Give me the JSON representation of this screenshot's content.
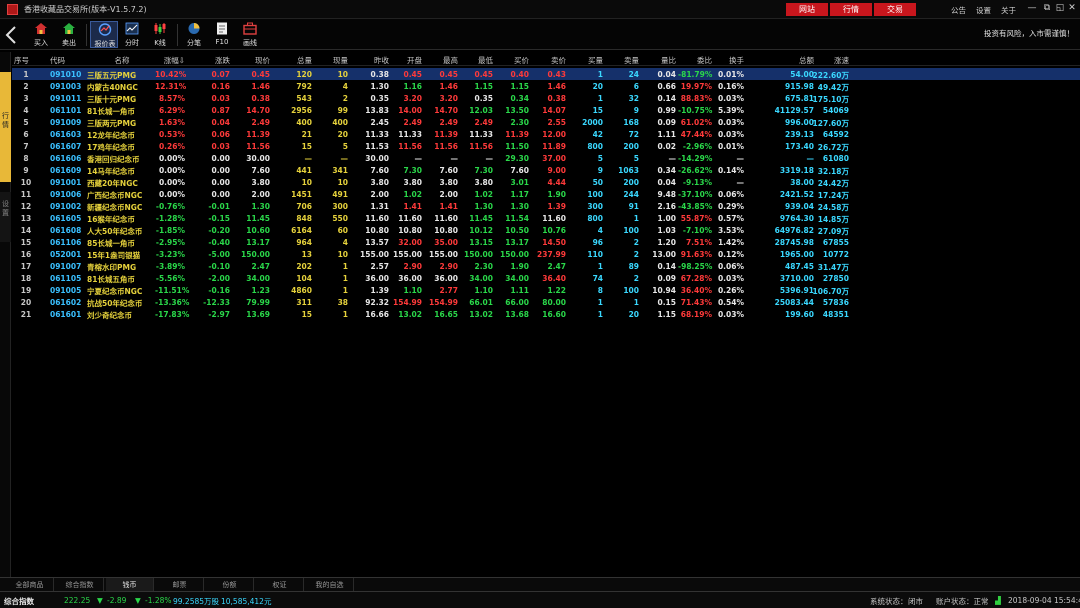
{
  "window": {
    "title": "香港收藏品交易所(版本-V1.5.7.2)",
    "tabs": [
      "网站",
      "行情",
      "交易"
    ],
    "menu": [
      "公告",
      "设置",
      "关于"
    ],
    "controls": [
      "—",
      "⧉",
      "◱",
      "✕"
    ]
  },
  "toolbar": {
    "items": [
      {
        "label": "买入",
        "icon": "house-icon"
      },
      {
        "label": "卖出",
        "icon": "house-icon"
      },
      {
        "label": "报价表",
        "icon": "quote-table-icon"
      },
      {
        "label": "分时",
        "icon": "timeshare-icon"
      },
      {
        "label": "K线",
        "icon": "candlestick-icon"
      },
      {
        "label": "分笔",
        "icon": "pie-icon"
      },
      {
        "label": "F10",
        "icon": "document-icon"
      },
      {
        "label": "画线",
        "icon": "briefcase-icon"
      }
    ],
    "risk_notice": "投资有风险，入市需谨慎！"
  },
  "side_tabs": [
    "行情",
    "设置"
  ],
  "colors": {
    "up": "#ff3a3a",
    "down": "#2ad84a",
    "accent_red": "#c8161d",
    "selected_row": "#15306a",
    "code": "#3ac0ff",
    "name": "#e6d23c"
  },
  "table": {
    "columns": [
      "序号",
      "代码",
      "名称",
      "涨幅⇩",
      "涨跌",
      "现价",
      "总量",
      "现量",
      "昨收",
      "开盘",
      "最高",
      "最低",
      "买价",
      "卖价",
      "买量",
      "卖量",
      "量比",
      "委比",
      "换手",
      "总额",
      "涨速"
    ],
    "rows": [
      {
        "no": "1",
        "code": "091010",
        "name": "三版五元PMG",
        "pct": "10.42%",
        "chg": "0.07",
        "price": "0.45",
        "vol": "120",
        "cur": "10",
        "prev": "0.38",
        "open": "0.45",
        "high": "0.45",
        "low": "0.45",
        "bid": "0.40",
        "ask": "0.43",
        "bv": "1",
        "av": "24",
        "vr": "0.04",
        "wb": "-81.79%",
        "hs": "0.01%",
        "amt": "54.00",
        "spd": "222.60万",
        "dir": "up"
      },
      {
        "no": "2",
        "code": "091003",
        "name": "内蒙古40NGC",
        "pct": "12.31%",
        "chg": "0.16",
        "price": "1.46",
        "vol": "792",
        "cur": "4",
        "prev": "1.30",
        "open": "1.16",
        "high": "1.46",
        "low": "1.15",
        "bid": "1.15",
        "ask": "1.46",
        "bv": "20",
        "av": "6",
        "vr": "0.66",
        "wb": "19.97%",
        "hs": "0.16%",
        "amt": "915.98",
        "spd": "49.42万",
        "dir": "up"
      },
      {
        "no": "3",
        "code": "091011",
        "name": "三版十元PMG",
        "pct": "8.57%",
        "chg": "0.03",
        "price": "0.38",
        "vol": "543",
        "cur": "2",
        "prev": "0.35",
        "open": "3.20",
        "high": "3.20",
        "low": "0.35",
        "bid": "0.34",
        "ask": "0.38",
        "bv": "1",
        "av": "32",
        "vr": "0.14",
        "wb": "88.83%",
        "hs": "0.03%",
        "amt": "675.81",
        "spd": "175.10万",
        "dir": "up"
      },
      {
        "no": "4",
        "code": "061101",
        "name": "81长城一角币",
        "pct": "6.29%",
        "chg": "0.87",
        "price": "14.70",
        "vol": "2956",
        "cur": "99",
        "prev": "13.83",
        "open": "14.00",
        "high": "14.70",
        "low": "12.03",
        "bid": "13.50",
        "ask": "14.07",
        "bv": "15",
        "av": "9",
        "vr": "0.99",
        "wb": "-10.75%",
        "hs": "5.39%",
        "amt": "41129.57",
        "spd": "54069",
        "dir": "up"
      },
      {
        "no": "5",
        "code": "091009",
        "name": "三版两元PMG",
        "pct": "1.63%",
        "chg": "0.04",
        "price": "2.49",
        "vol": "400",
        "cur": "400",
        "prev": "2.45",
        "open": "2.49",
        "high": "2.49",
        "low": "2.49",
        "bid": "2.30",
        "ask": "2.55",
        "bv": "2000",
        "av": "168",
        "vr": "0.09",
        "wb": "61.02%",
        "hs": "0.03%",
        "amt": "996.00",
        "spd": "127.60万",
        "dir": "up"
      },
      {
        "no": "6",
        "code": "061603",
        "name": "12龙年纪念币",
        "pct": "0.53%",
        "chg": "0.06",
        "price": "11.39",
        "vol": "21",
        "cur": "20",
        "prev": "11.33",
        "open": "11.33",
        "high": "11.39",
        "low": "11.33",
        "bid": "11.39",
        "ask": "12.00",
        "bv": "42",
        "av": "72",
        "vr": "1.11",
        "wb": "47.44%",
        "hs": "0.03%",
        "amt": "239.13",
        "spd": "64592",
        "dir": "up"
      },
      {
        "no": "7",
        "code": "061607",
        "name": "17鸡年纪念币",
        "pct": "0.26%",
        "chg": "0.03",
        "price": "11.56",
        "vol": "15",
        "cur": "5",
        "prev": "11.53",
        "open": "11.56",
        "high": "11.56",
        "low": "11.56",
        "bid": "11.50",
        "ask": "11.89",
        "bv": "800",
        "av": "200",
        "vr": "0.02",
        "wb": "-2.96%",
        "hs": "0.01%",
        "amt": "173.40",
        "spd": "26.72万",
        "dir": "up"
      },
      {
        "no": "8",
        "code": "061606",
        "name": "香港回归纪念币",
        "pct": "0.00%",
        "chg": "0.00",
        "price": "30.00",
        "vol": "—",
        "cur": "—",
        "prev": "30.00",
        "open": "—",
        "high": "—",
        "low": "—",
        "bid": "29.30",
        "ask": "37.00",
        "bv": "5",
        "av": "5",
        "vr": "—",
        "wb": "-14.29%",
        "hs": "—",
        "amt": "—",
        "spd": "61080",
        "dir": "eq"
      },
      {
        "no": "9",
        "code": "061609",
        "name": "14马年纪念币",
        "pct": "0.00%",
        "chg": "0.00",
        "price": "7.60",
        "vol": "441",
        "cur": "341",
        "prev": "7.60",
        "open": "7.30",
        "high": "7.60",
        "low": "7.30",
        "bid": "7.60",
        "ask": "9.00",
        "bv": "9",
        "av": "1063",
        "vr": "0.34",
        "wb": "-26.62%",
        "hs": "0.14%",
        "amt": "3319.18",
        "spd": "32.18万",
        "dir": "eq"
      },
      {
        "no": "10",
        "code": "091001",
        "name": "西藏20年NGC",
        "pct": "0.00%",
        "chg": "0.00",
        "price": "3.80",
        "vol": "10",
        "cur": "10",
        "prev": "3.80",
        "open": "3.80",
        "high": "3.80",
        "low": "3.80",
        "bid": "3.01",
        "ask": "4.44",
        "bv": "50",
        "av": "200",
        "vr": "0.04",
        "wb": "-9.13%",
        "hs": "—",
        "amt": "38.00",
        "spd": "24.42万",
        "dir": "eq"
      },
      {
        "no": "11",
        "code": "091006",
        "name": "广西纪念币NGC",
        "pct": "0.00%",
        "chg": "0.00",
        "price": "2.00",
        "vol": "1451",
        "cur": "491",
        "prev": "2.00",
        "open": "1.02",
        "high": "2.00",
        "low": "1.02",
        "bid": "1.17",
        "ask": "1.90",
        "bv": "100",
        "av": "244",
        "vr": "9.48",
        "wb": "-37.10%",
        "hs": "0.06%",
        "amt": "2421.52",
        "spd": "17.24万",
        "dir": "eq"
      },
      {
        "no": "12",
        "code": "091002",
        "name": "新疆纪念币NGC",
        "pct": "-0.76%",
        "chg": "-0.01",
        "price": "1.30",
        "vol": "706",
        "cur": "300",
        "prev": "1.31",
        "open": "1.41",
        "high": "1.41",
        "low": "1.30",
        "bid": "1.30",
        "ask": "1.39",
        "bv": "300",
        "av": "91",
        "vr": "2.16",
        "wb": "-43.85%",
        "hs": "0.29%",
        "amt": "939.04",
        "spd": "24.58万",
        "dir": "dn"
      },
      {
        "no": "13",
        "code": "061605",
        "name": "16猴年纪念币",
        "pct": "-1.28%",
        "chg": "-0.15",
        "price": "11.45",
        "vol": "848",
        "cur": "550",
        "prev": "11.60",
        "open": "11.60",
        "high": "11.60",
        "low": "11.45",
        "bid": "11.54",
        "ask": "11.60",
        "bv": "800",
        "av": "1",
        "vr": "1.00",
        "wb": "55.87%",
        "hs": "0.57%",
        "amt": "9764.30",
        "spd": "14.85万",
        "dir": "dn"
      },
      {
        "no": "14",
        "code": "061608",
        "name": "人大50年纪念币",
        "pct": "-1.85%",
        "chg": "-0.20",
        "price": "10.60",
        "vol": "6164",
        "cur": "60",
        "prev": "10.80",
        "open": "10.80",
        "high": "10.80",
        "low": "10.12",
        "bid": "10.50",
        "ask": "10.76",
        "bv": "4",
        "av": "100",
        "vr": "1.03",
        "wb": "-7.10%",
        "hs": "3.53%",
        "amt": "64976.82",
        "spd": "27.09万",
        "dir": "dn"
      },
      {
        "no": "15",
        "code": "061106",
        "name": "85长城一角币",
        "pct": "-2.95%",
        "chg": "-0.40",
        "price": "13.17",
        "vol": "964",
        "cur": "4",
        "prev": "13.57",
        "open": "32.00",
        "high": "35.00",
        "low": "13.15",
        "bid": "13.17",
        "ask": "14.50",
        "bv": "96",
        "av": "2",
        "vr": "1.20",
        "wb": "7.51%",
        "hs": "1.42%",
        "amt": "28745.98",
        "spd": "67855",
        "dir": "dn"
      },
      {
        "no": "16",
        "code": "052001",
        "name": "15年1盎司银猫",
        "pct": "-3.23%",
        "chg": "-5.00",
        "price": "150.00",
        "vol": "13",
        "cur": "10",
        "prev": "155.00",
        "open": "155.00",
        "high": "155.00",
        "low": "150.00",
        "bid": "150.00",
        "ask": "237.99",
        "bv": "110",
        "av": "2",
        "vr": "13.00",
        "wb": "91.63%",
        "hs": "0.12%",
        "amt": "1965.00",
        "spd": "10772",
        "dir": "dn"
      },
      {
        "no": "17",
        "code": "091007",
        "name": "青榕水印PMG",
        "pct": "-3.89%",
        "chg": "-0.10",
        "price": "2.47",
        "vol": "202",
        "cur": "1",
        "prev": "2.57",
        "open": "2.90",
        "high": "2.90",
        "low": "2.30",
        "bid": "1.90",
        "ask": "2.47",
        "bv": "1",
        "av": "89",
        "vr": "0.14",
        "wb": "-98.25%",
        "hs": "0.06%",
        "amt": "487.45",
        "spd": "31.47万",
        "dir": "dn"
      },
      {
        "no": "18",
        "code": "061105",
        "name": "81长城五角币",
        "pct": "-5.56%",
        "chg": "-2.00",
        "price": "34.00",
        "vol": "104",
        "cur": "1",
        "prev": "36.00",
        "open": "36.00",
        "high": "36.00",
        "low": "34.00",
        "bid": "34.00",
        "ask": "36.40",
        "bv": "74",
        "av": "2",
        "vr": "0.09",
        "wb": "67.28%",
        "hs": "0.03%",
        "amt": "3710.00",
        "spd": "27850",
        "dir": "dn"
      },
      {
        "no": "19",
        "code": "091005",
        "name": "宁夏纪念币NGC",
        "pct": "-11.51%",
        "chg": "-0.16",
        "price": "1.23",
        "vol": "4860",
        "cur": "1",
        "prev": "1.39",
        "open": "1.10",
        "high": "2.77",
        "low": "1.10",
        "bid": "1.11",
        "ask": "1.22",
        "bv": "8",
        "av": "100",
        "vr": "10.94",
        "wb": "36.40%",
        "hs": "0.26%",
        "amt": "5396.91",
        "spd": "106.70万",
        "dir": "dn"
      },
      {
        "no": "20",
        "code": "061602",
        "name": "抗战50年纪念币",
        "pct": "-13.36%",
        "chg": "-12.33",
        "price": "79.99",
        "vol": "311",
        "cur": "38",
        "prev": "92.32",
        "open": "154.99",
        "high": "154.99",
        "low": "66.01",
        "bid": "66.00",
        "ask": "80.00",
        "bv": "1",
        "av": "1",
        "vr": "0.15",
        "wb": "71.43%",
        "hs": "0.54%",
        "amt": "25083.44",
        "spd": "57836",
        "dir": "dn"
      },
      {
        "no": "21",
        "code": "061601",
        "name": "刘少奇纪念币",
        "pct": "-17.83%",
        "chg": "-2.97",
        "price": "13.69",
        "vol": "15",
        "cur": "1",
        "prev": "16.66",
        "open": "13.02",
        "high": "16.65",
        "low": "13.02",
        "bid": "13.68",
        "ask": "16.60",
        "bv": "1",
        "av": "20",
        "vr": "1.15",
        "wb": "68.19%",
        "hs": "0.03%",
        "amt": "199.60",
        "spd": "48351",
        "dir": "dn"
      }
    ]
  },
  "bottom_tabs": [
    "全部商品",
    "综合指数",
    "钱币",
    "邮票",
    "份额",
    "权证",
    "我的自选"
  ],
  "bottom_active": "钱币",
  "status": {
    "index_label": "综合指数",
    "index_value": "222.25",
    "index_change": "-2.89",
    "index_pct": "-1.28%",
    "volume": "99.2585万股",
    "amount": "10,585,412元",
    "system_label": "系统状态：",
    "system_value": "闭市",
    "account_label": "账户状态：正常",
    "datetime": "2018-09-04 15:54:42"
  }
}
